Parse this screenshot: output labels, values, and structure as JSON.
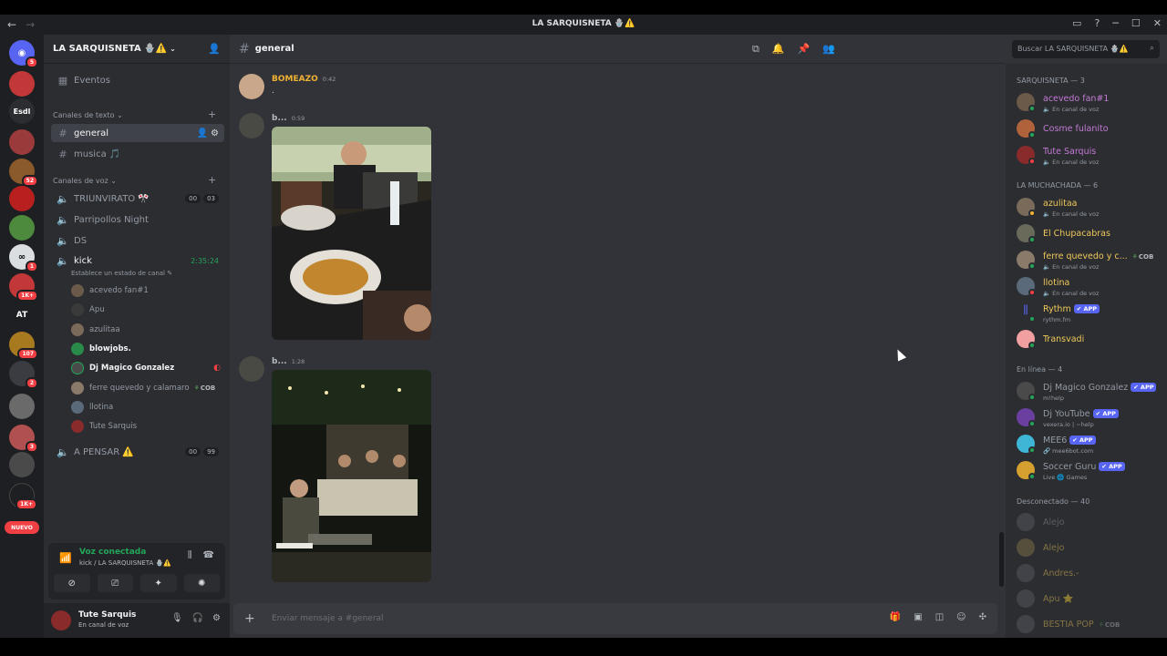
{
  "window": {
    "title": "LA SARQUISNETA 🪬⚠️"
  },
  "server": {
    "name": "LA SARQUISNETA 🪬⚠️"
  },
  "rail": {
    "acronyms": [
      "Esdl",
      "AT"
    ],
    "badges": [
      "5",
      "52",
      "1",
      "1K+",
      "107",
      "2",
      "3",
      "1K+"
    ],
    "new_label": "NUEVO"
  },
  "sidebar": {
    "events_label": "Eventos",
    "text_category": "Canales de texto",
    "text_channels": [
      {
        "name": "general"
      },
      {
        "name": "musica 🎵"
      }
    ],
    "voice_category": "Canales de voz",
    "voice_channels": [
      {
        "name": "TRIUNVIRATO 🎌",
        "left": "00",
        "right": "03"
      },
      {
        "name": "Parripollos Night"
      },
      {
        "name": "DS"
      },
      {
        "name": "kick",
        "timer": "2:35:24",
        "status": "Establece un estado de canal"
      },
      {
        "name": "A PENSAR ⚠️",
        "left": "00",
        "right": "99"
      }
    ],
    "voice_users": [
      {
        "name": "acevedo fan#1"
      },
      {
        "name": "Apu"
      },
      {
        "name": "azulitaa"
      },
      {
        "name": "blowjobs."
      },
      {
        "name": "Dj Magico Gonzalez"
      },
      {
        "name": "ferre quevedo y calamaro",
        "tag": "COB"
      },
      {
        "name": "llotina"
      },
      {
        "name": "Tute Sarquis"
      }
    ]
  },
  "voice_panel": {
    "title": "Voz conectada",
    "subtitle": "kick / LA SARQUISNETA 🪬⚠️"
  },
  "user_panel": {
    "name": "Tute Sarquis",
    "status": "En canal de voz"
  },
  "chat": {
    "channel": "general",
    "messages": [
      {
        "author": "BOMEAZO",
        "time": "0:42",
        "text": "."
      },
      {
        "author": "b...",
        "time": "0:59"
      },
      {
        "author": "b...",
        "time": "1:28"
      }
    ],
    "input_placeholder": "Enviar mensaje a #general"
  },
  "search": {
    "placeholder": "Buscar LA SARQUISNETA 🪬⚠️"
  },
  "members": {
    "groups": [
      {
        "title": "SARQUISNETA — 3"
      },
      {
        "title": "LA MUCHACHADA — 6"
      },
      {
        "title": "En línea — 4"
      },
      {
        "title": "Desconectado — 40"
      }
    ],
    "list": [
      {
        "name": "acevedo fan#1",
        "sub": "🔈 En canal de voz",
        "color": "#c47ad6"
      },
      {
        "name": "Cosme fulanito",
        "sub": "",
        "color": "#c47ad6"
      },
      {
        "name": "Tute Sarquis",
        "sub": "🔈 En canal de voz",
        "color": "#c47ad6"
      },
      {
        "name": "azulitaa",
        "sub": "🔈 En canal de voz",
        "color": "#f0c85a"
      },
      {
        "name": "El Chupacabras",
        "sub": "",
        "color": "#f0c85a"
      },
      {
        "name": "ferre quevedo y c...",
        "sub": "🔈 En canal de voz",
        "color": "#f0c85a",
        "tag": "COB"
      },
      {
        "name": "llotina",
        "sub": "🔈 En canal de voz",
        "color": "#f0c85a"
      },
      {
        "name": "Rythm",
        "sub": "rythm.fm",
        "color": "#f0c85a",
        "app": "APP"
      },
      {
        "name": "Transvadi",
        "sub": "",
        "color": "#f0c85a"
      },
      {
        "name": "Dj Magico Gonzalez",
        "sub": "m!help",
        "color": "#949ba4",
        "app": "APP"
      },
      {
        "name": "Dj YouTube",
        "sub": "vexera.io | ~help",
        "color": "#949ba4",
        "app": "APP"
      },
      {
        "name": "MEE6",
        "sub": "🔗 mee6bot.com",
        "color": "#949ba4",
        "app": "APP"
      },
      {
        "name": "Soccer Guru",
        "sub": "Live 🌐 Games",
        "color": "#949ba4",
        "app": "APP"
      },
      {
        "name": "Alejo",
        "sub": "",
        "color": "#949ba4"
      },
      {
        "name": "Alejo",
        "sub": "",
        "color": "#f0c85a"
      },
      {
        "name": "Andres.-",
        "sub": "",
        "color": "#f0c85a"
      },
      {
        "name": "Apu ⭐",
        "sub": "",
        "color": "#f0c85a"
      },
      {
        "name": "BESTIA POP",
        "sub": "",
        "color": "#f0c85a",
        "tag": "COB"
      }
    ]
  }
}
